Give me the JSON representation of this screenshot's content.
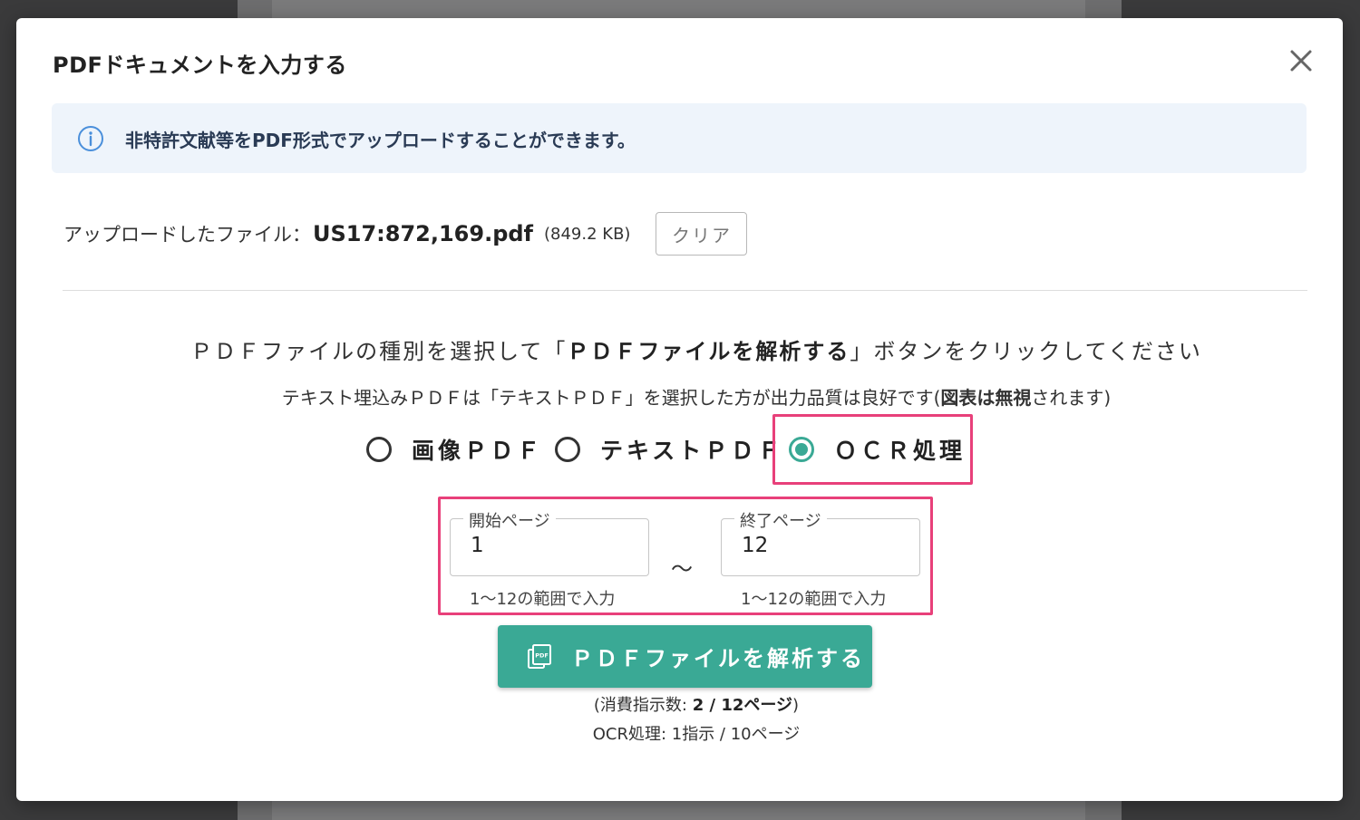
{
  "modal": {
    "title": "PDFドキュメントを入力する",
    "info_text": "非特許文献等をPDF形式でアップロードすることができます。"
  },
  "upload": {
    "label": "アップロードしたファイル：",
    "file_name": "US17:872,169.pdf",
    "file_size": "(849.2 KB)",
    "clear_label": "クリア"
  },
  "instruction": {
    "prefix": "ＰＤＦファイルの種別を選択して「",
    "bold": "ＰＤＦファイルを解析する",
    "suffix": "」ボタンをクリックしてください"
  },
  "note": {
    "prefix": "テキスト埋込みＰＤＦは「テキストＰＤＦ」を選択した方が出力品質は良好です(",
    "bold": "図表は無視",
    "suffix": "されます)"
  },
  "pdf_type": {
    "options": [
      {
        "label": "画像ＰＤＦ",
        "checked": false
      },
      {
        "label": "テキストＰＤＦ",
        "checked": false
      },
      {
        "label": "ＯＣＲ処理",
        "checked": true
      }
    ]
  },
  "range": {
    "start": {
      "label": "開始ページ",
      "value": "1",
      "help": "1〜12の範囲で入力"
    },
    "separator": "〜",
    "end": {
      "label": "終了ページ",
      "value": "12",
      "help": "1〜12の範囲で入力"
    }
  },
  "analyze_button": {
    "label": "ＰＤＦファイルを解析する",
    "icon": "pdf-file-icon"
  },
  "consumption": {
    "prefix": "(消費指示数: ",
    "value": "2 / 12ページ",
    "suffix": ")",
    "ocr_rate": "OCR処理: 1指示 / 10ページ"
  },
  "colors": {
    "accent": "#3aa995",
    "highlight": "#e8407a",
    "info_bg": "#eef4fb"
  }
}
